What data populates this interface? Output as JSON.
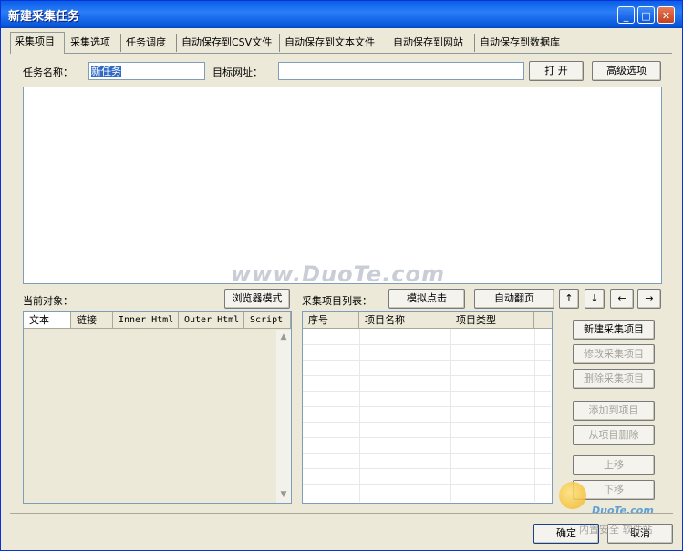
{
  "window": {
    "title": "新建采集任务",
    "controls": {
      "minimize": "_",
      "maximize": "□",
      "close": "✕"
    }
  },
  "tabs": [
    {
      "label": "采集项目",
      "active": true
    },
    {
      "label": "采集选项"
    },
    {
      "label": "任务调度"
    },
    {
      "label": "自动保存到CSV文件"
    },
    {
      "label": "自动保存到文本文件"
    },
    {
      "label": "自动保存到网站"
    },
    {
      "label": "自动保存到数据库"
    }
  ],
  "form": {
    "task_name_label": "任务名称：",
    "task_name_value": "新任务",
    "target_url_label": "目标网址：",
    "target_url_value": "",
    "open_button": "打 开",
    "advanced_button": "高级选项"
  },
  "current_object": {
    "label": "当前对象：",
    "browser_mode_button": "浏览器模式",
    "columns": [
      "文本",
      "链接",
      "Inner Html",
      "Outer Html",
      "Script"
    ]
  },
  "collect_list": {
    "label": "采集项目列表：",
    "simulate_click_button": "模拟点击",
    "auto_page_button": "自动翻页",
    "nav_buttons": [
      "↑",
      "↓",
      "←",
      "→"
    ],
    "columns": [
      "序号",
      "项目名称",
      "项目类型"
    ]
  },
  "side_buttons": [
    {
      "label": "新建采集项目",
      "enabled": true
    },
    {
      "label": "修改采集项目",
      "enabled": false
    },
    {
      "label": "删除采集项目",
      "enabled": false
    },
    {
      "label": "添加到项目",
      "enabled": false
    },
    {
      "label": "从项目删除",
      "enabled": false
    },
    {
      "label": "上移",
      "enabled": false
    },
    {
      "label": "下移",
      "enabled": false
    }
  ],
  "footer": {
    "ok_button": "确定",
    "cancel_button": "取消"
  },
  "watermark": {
    "site": "www.DuoTe.com",
    "logo_text": "DuoTe.com",
    "slogan": "内置安全 软件站"
  }
}
